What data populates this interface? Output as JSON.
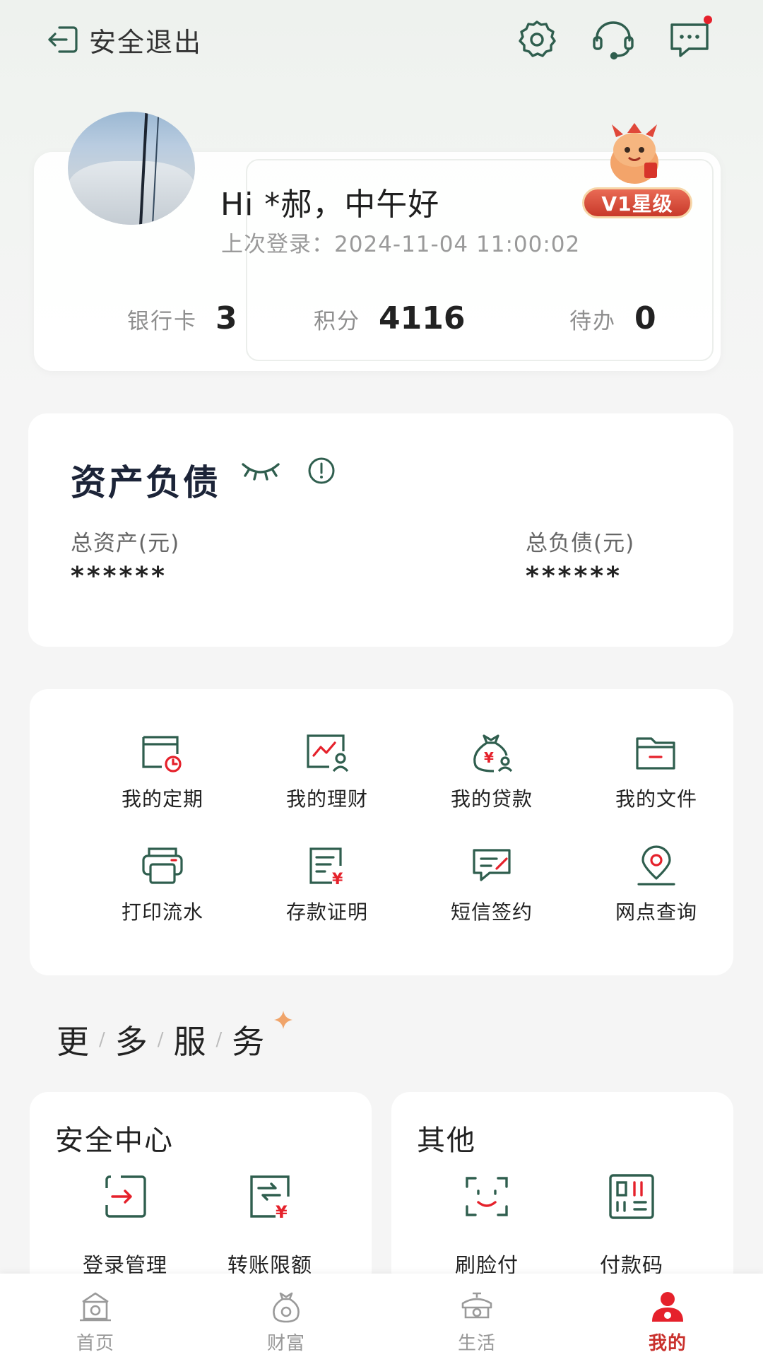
{
  "header": {
    "logout_label": "安全退出",
    "settings_icon": "gear-icon",
    "support_icon": "headset-icon",
    "messages_icon": "message-icon",
    "has_unread": true
  },
  "profile": {
    "greeting": "Hi *郝，中午好",
    "last_login": "上次登录：2024-11-04 11:00:02",
    "level": "V1星级",
    "stats": {
      "bank_card_label": "银行卡",
      "bank_card_value": "3",
      "points_label": "积分",
      "points_value": "4116",
      "todo_label": "待办",
      "todo_value": "0"
    }
  },
  "assets": {
    "title": "资产负债",
    "total_assets_label": "总资产(元)",
    "total_assets_value": "******",
    "total_liabilities_label": "总负债(元)",
    "total_liabilities_value": "******"
  },
  "services": [
    {
      "label": "我的定期",
      "icon": "calendar-clock-icon"
    },
    {
      "label": "我的理财",
      "icon": "wealth-chart-icon"
    },
    {
      "label": "我的贷款",
      "icon": "loan-bag-icon"
    },
    {
      "label": "我的文件",
      "icon": "folder-icon"
    },
    {
      "label": "打印流水",
      "icon": "printer-icon"
    },
    {
      "label": "存款证明",
      "icon": "deposit-certificate-icon"
    },
    {
      "label": "短信签约",
      "icon": "sms-sign-icon"
    },
    {
      "label": "网点查询",
      "icon": "location-pin-icon"
    }
  ],
  "more_services": {
    "title_chars": [
      "更",
      "多",
      "服",
      "务"
    ]
  },
  "security_center": {
    "title": "安全中心",
    "items": [
      {
        "label": "登录管理",
        "icon": "login-icon"
      },
      {
        "label": "转账限额",
        "icon": "transfer-limit-icon"
      }
    ]
  },
  "others": {
    "title": "其他",
    "items": [
      {
        "label": "刷脸付",
        "icon": "face-pay-icon"
      },
      {
        "label": "付款码",
        "icon": "payment-code-icon"
      }
    ]
  },
  "bottom_nav": [
    {
      "label": "首页",
      "icon": "home-icon",
      "active": false
    },
    {
      "label": "财富",
      "icon": "wealth-icon",
      "active": false
    },
    {
      "label": "生活",
      "icon": "life-icon",
      "active": false
    },
    {
      "label": "我的",
      "icon": "profile-icon",
      "active": true
    }
  ],
  "colors": {
    "accent_green": "#2f5e4e",
    "accent_red": "#e5212b",
    "active_nav": "#c9302c"
  }
}
